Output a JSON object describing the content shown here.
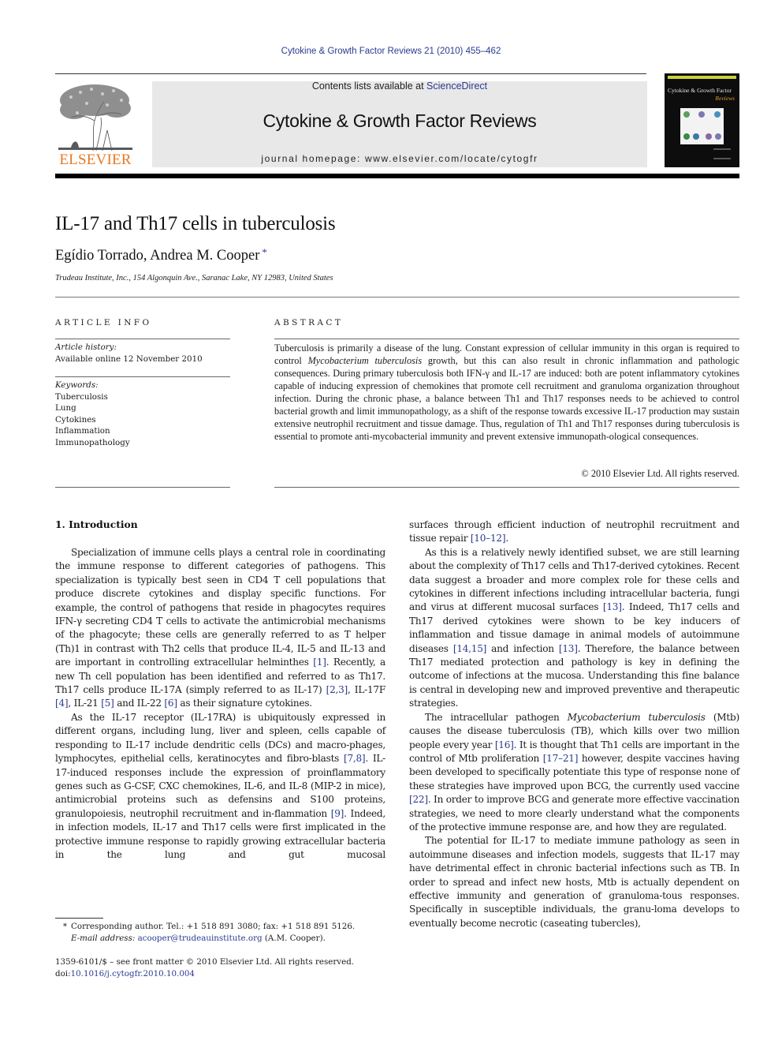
{
  "running_head": "Cytokine & Growth Factor Reviews 21 (2010) 455–462",
  "masthead": {
    "publisher_logo_icon": "elsevier-tree-icon",
    "publisher_name": "ELSEVIER",
    "contents_prefix": "Contents lists available at ",
    "contents_link": "ScienceDirect",
    "journal_name": "Cytokine & Growth Factor Reviews",
    "homepage_prefix": "journal homepage: ",
    "homepage_url": "www.elsevier.com/locate/cytogfr",
    "cover_title": "Cytokine & Growth Factor",
    "cover_subtitle": "Reviews",
    "colors": {
      "publisher_orange": "#e87722",
      "link_blue": "#2b3a8f",
      "masthead_gray": "#e8e8e8"
    }
  },
  "article": {
    "title": "IL-17 and Th17 cells in tuberculosis",
    "authors": "Egídio Torrado, Andrea M. Cooper",
    "corresponding_marker": "*",
    "affiliation": "Trudeau Institute, Inc., 154 Algonquin Ave., Saranac Lake, NY 12983, United States"
  },
  "article_info": {
    "heading": "ARTICLE INFO",
    "history_label": "Article history:",
    "history_value": "Available online 12 November 2010",
    "keywords_label": "Keywords:",
    "keywords": [
      "Tuberculosis",
      "Lung",
      "Cytokines",
      "Inflammation",
      "Immunopathology"
    ]
  },
  "abstract": {
    "heading": "ABSTRACT",
    "part1": "Tuberculosis is primarily a disease of the lung. Constant expression of cellular immunity in this organ is required to control ",
    "organism": "Mycobacterium tuberculosis",
    "part2": " growth, but this can also result in chronic inflammation and pathologic consequences. During primary tuberculosis both IFN-γ and IL-17 are induced: both are potent inflammatory cytokines capable of inducing expression of chemokines that promote cell recruitment and granuloma organization throughout infection. During the chronic phase, a balance between Th1 and Th17 responses needs to be achieved to control bacterial growth and limit immunopathology, as a shift of the response towards excessive IL-17 production may sustain extensive neutrophil recruitment and tissue damage. Thus, regulation of Th1 and Th17 responses during tuberculosis is essential to promote anti-mycobacterial immunity and prevent extensive immunopath-ological consequences.",
    "copyright": "© 2010 Elsevier Ltd. All rights reserved."
  },
  "introduction": {
    "heading": "1.  Introduction",
    "p1": {
      "t1": "Specialization of immune cells plays a central role in coordinating the immune response to different categories of pathogens. This specialization is typically best seen in CD4 T cell populations that produce discrete cytokines and display specific functions. For example, the control of pathogens that reside in phagocytes requires IFN-γ secreting CD4 T cells to activate the antimicrobial mechanisms of the phagocyte; these cells are generally referred to as T helper (Th)1 in contrast with Th2 cells that produce IL-4, IL-5 and IL-13 and are important in controlling extracellular helminthes ",
      "r1": "[1]",
      "t2": ". Recently, a new Th cell population has been identified and referred to as Th17. Th17 cells produce IL-17A (simply referred to as IL-17) ",
      "r2": "[2,3]",
      "t3": ", IL-17F ",
      "r3": "[4]",
      "t4": ", IL-21 ",
      "r4": "[5]",
      "t5": " and IL-22 ",
      "r5": "[6]",
      "t6": " as their signature cytokines."
    },
    "p2": {
      "t1": "As the IL-17 receptor (IL-17RA) is ubiquitously expressed in different organs, including lung, liver and spleen, cells capable of responding to IL-17 include dendritic cells (DCs) and macro-phages, lymphocytes, epithelial cells, keratinocytes and fibro-blasts ",
      "r1": "[7,8]",
      "t2": ". IL-17-induced responses include the expression of proinflammatory genes such as G-CSF, CXC chemokines, IL-6, and IL-8 (MIP-2 in mice), antimicrobial proteins such as defensins and S100 proteins, granulopoiesis, neutrophil recruitment and in-flammation ",
      "r2": "[9]",
      "t3": ". Indeed, in infection models, IL-17 and Th17 cells were first implicated in the protective immune response to rapidly growing extracellular bacteria in the lung and gut mucosal surfaces through efficient induction of neutrophil recruitment and tissue repair ",
      "r3": "[10–12]",
      "t4": "."
    },
    "p3": {
      "t1": "As this is a relatively newly identified subset, we are still learning about the complexity of Th17 cells and Th17-derived cytokines. Recent data suggest a broader and more complex role for these cells and cytokines in different infections including intracellular bacteria, fungi and virus at different mucosal surfaces ",
      "r1": "[13]",
      "t2": ". Indeed, Th17 cells and Th17 derived cytokines were shown to be key inducers of inflammation and tissue damage in animal models of autoimmune diseases ",
      "r2": "[14,15]",
      "t3": " and infection ",
      "r3": "[13]",
      "t4": ". Therefore, the balance between Th17 mediated protection and pathology is key in defining the outcome of infections at the mucosa. Understanding this fine balance is central in developing new and improved preventive and therapeutic strategies."
    },
    "p4": {
      "t0": "The intracellular pathogen ",
      "organism": "Mycobacterium tuberculosis",
      "t1": " (Mtb) causes the disease tuberculosis (TB), which kills over two million people every year ",
      "r1": "[16]",
      "t2": ". It is thought that Th1 cells are important in the control of Mtb proliferation ",
      "r2": "[17–21]",
      "t3": " however, despite vaccines having been developed to specifically potentiate this type of response none of these strategies have improved upon BCG, the currently used vaccine ",
      "r3": "[22]",
      "t4": ". In order to improve BCG and generate more effective vaccination strategies, we need to more clearly understand what the components of the protective immune response are, and how they are regulated."
    },
    "p5": {
      "t1": "The potential for IL-17 to mediate immune pathology as seen in autoimmune diseases and infection models, suggests that IL-17 may have detrimental effect in chronic bacterial infections such as TB. In order to spread and infect new hosts, Mtb is actually dependent on effective immunity and generation of granuloma-tous responses. Specifically in susceptible individuals, the granu-loma develops to eventually become necrotic (caseating tubercles),"
    }
  },
  "footnote": {
    "marker": "*",
    "corresponding": "Corresponding author. Tel.: +1 518 891 3080; fax: +1 518 891 5126.",
    "email_label": "E-mail address:",
    "email": "acooper@trudeauinstitute.org",
    "email_suffix": " (A.M. Cooper)."
  },
  "front_matter": {
    "issn_line": "1359-6101/$ – see front matter © 2010 Elsevier Ltd. All rights reserved.",
    "doi_label": "doi:",
    "doi": "10.1016/j.cytogfr.2010.10.004"
  }
}
